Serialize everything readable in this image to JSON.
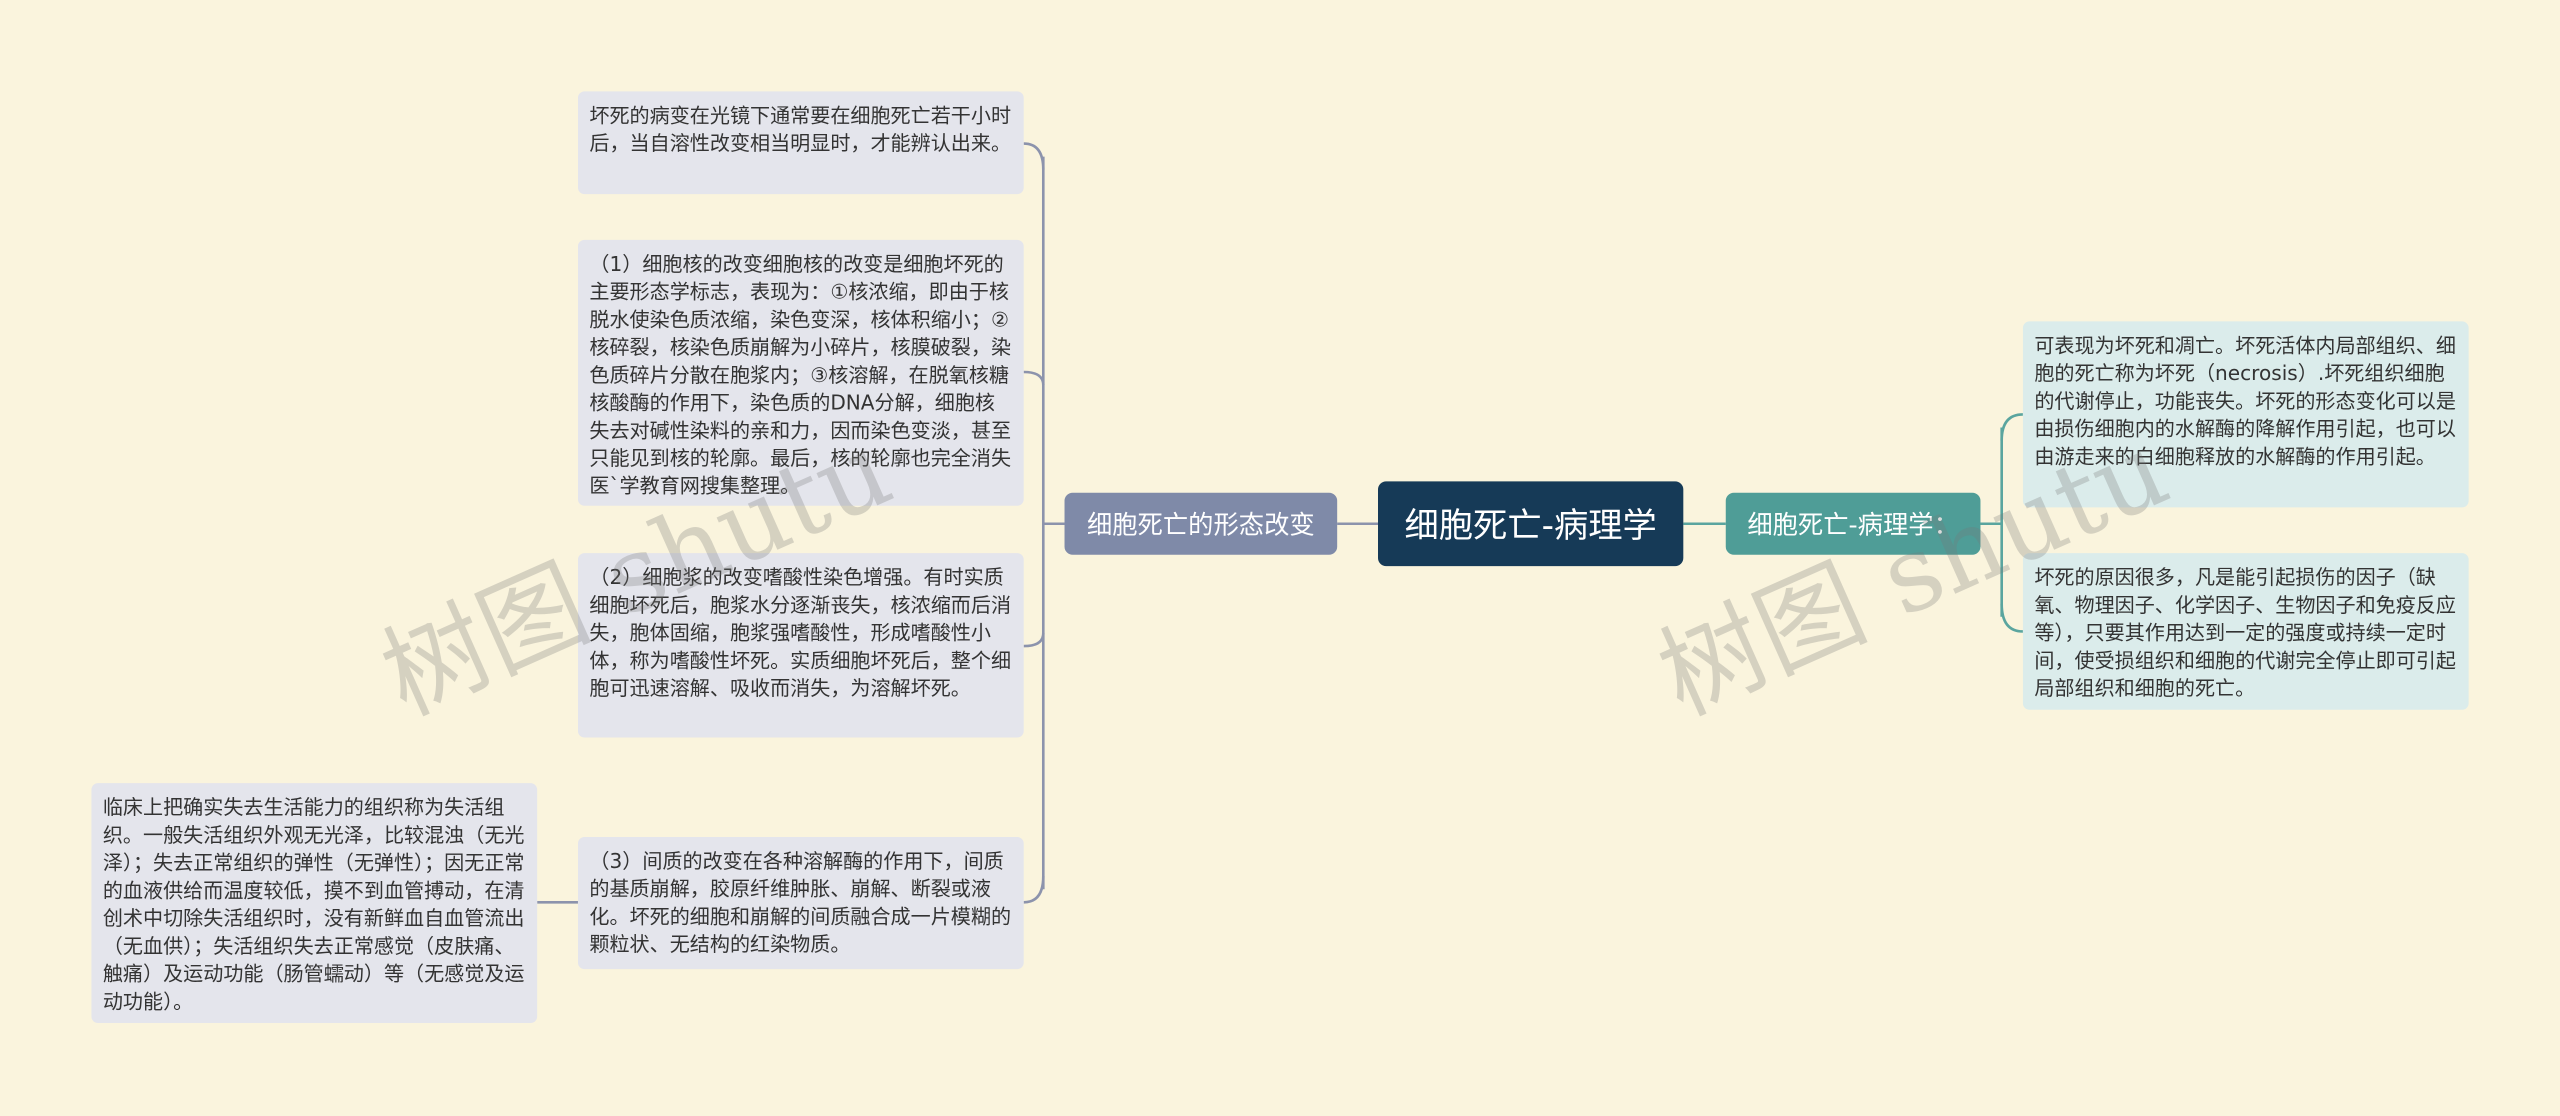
{
  "root": {
    "title": "细胞死亡-病理学"
  },
  "left_branch": {
    "label": "细胞死亡的形态改变",
    "children": [
      {
        "text": "坏死的病变在光镜下通常要在细胞死亡若干小时后，当自溶性改变相当明显时，才能辨认出来。"
      },
      {
        "text": "（1）细胞核的改变细胞核的改变是细胞坏死的主要形态学标志，表现为：①核浓缩，即由于核脱水使染色质浓缩，染色变深，核体积缩小；②核碎裂，核染色质崩解为小碎片，核膜破裂，染色质碎片分散在胞浆内；③核溶解，在脱氧核糖核酸酶的作用下，染色质的DNA分解，细胞核失去对碱性染料的亲和力，因而染色变淡，甚至只能见到核的轮廓。最后，核的轮廓也完全消失医`学教育网搜集整理。"
      },
      {
        "text": "（2）细胞浆的改变嗜酸性染色增强。有时实质细胞坏死后，胞浆水分逐渐丧失，核浓缩而后消失，胞体固缩，胞浆强嗜酸性，形成嗜酸性小体，称为嗜酸性坏死。实质细胞坏死后，整个细胞可迅速溶解、吸收而消失，为溶解坏死。"
      },
      {
        "text": "（3）间质的改变在各种溶解酶的作用下，间质的基质崩解，胶原纤维肿胀、崩解、断裂或液化。坏死的细胞和崩解的间质融合成一片模糊的颗粒状、无结构的红染物质。"
      }
    ],
    "sub_child": {
      "text": "临床上把确实失去生活能力的组织称为失活组织。一般失活组织外观无光泽，比较混浊（无光泽）；失去正常组织的弹性（无弹性）；因无正常的血液供给而温度较低，摸不到血管搏动，在清创术中切除失活组织时，没有新鲜血自血管流出（无血供）；失活组织失去正常感觉（皮肤痛、触痛）及运动功能（肠管蠕动）等（无感觉及运动功能）。"
    }
  },
  "right_branch": {
    "label": "细胞死亡-病理学：",
    "children": [
      {
        "text": "可表现为坏死和凋亡。坏死活体内局部组织、细胞的死亡称为坏死（necrosis）.坏死组织细胞的代谢停止，功能丧失。坏死的形态变化可以是由损伤细胞内的水解酶的降解作用引起，也可以由游走来的白细胞释放的水解酶的作用引起。"
      },
      {
        "text": "坏死的原因很多，凡是能引起损伤的因子（缺氧、物理因子、化学因子、生物因子和免疫反应等），只要其作用达到一定的强度或持续一定时间，使受损组织和细胞的代谢完全停止即可引起局部组织和细胞的死亡。"
      }
    ]
  },
  "watermarks": [
    "树图 shutu",
    "树图 shutu"
  ],
  "colors": {
    "background": "#faf4dd",
    "root": "#163a57",
    "left_branch": "#7f8aa8",
    "right_branch": "#4f9d97",
    "left_leaf": "#e4e5ec",
    "right_leaf": "#dbeceb",
    "left_link": "#8c93ac",
    "right_link": "#5aa59f"
  }
}
